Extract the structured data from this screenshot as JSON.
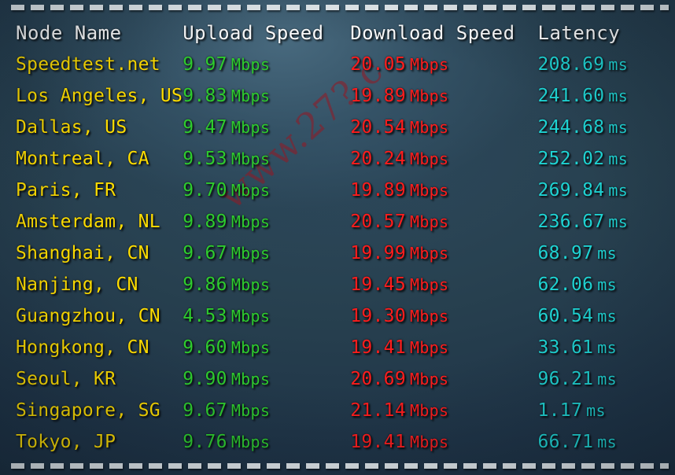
{
  "watermark": {
    "text": "www.27?.c"
  },
  "colors": {
    "node": "#ffdd00",
    "upload": "#2ecc2e",
    "download": "#ff1d1d",
    "latency": "#1fd3d3",
    "header": "#ffffff",
    "background": "#27404f",
    "rule": "#e8eef1",
    "watermark": "#961822"
  },
  "units": {
    "speed": "Mbps",
    "latency": "ms"
  },
  "table": {
    "headers": {
      "node": "Node Name",
      "upload": "Upload Speed",
      "download": "Download Speed",
      "latency": "Latency"
    },
    "rows": [
      {
        "node": "Speedtest.net",
        "upload": "9.97",
        "upload_unit": "Mbps",
        "download": "20.05",
        "download_unit": "Mbps",
        "latency": "208.69",
        "latency_unit": "ms"
      },
      {
        "node": "Los Angeles, US",
        "upload": "9.83",
        "upload_unit": "Mbps",
        "download": "19.89",
        "download_unit": "Mbps",
        "latency": "241.60",
        "latency_unit": "ms"
      },
      {
        "node": "Dallas, US",
        "upload": "9.47",
        "upload_unit": "Mbps",
        "download": "20.54",
        "download_unit": "Mbps",
        "latency": "244.68",
        "latency_unit": "ms"
      },
      {
        "node": "Montreal, CA",
        "upload": "9.53",
        "upload_unit": "Mbps",
        "download": "20.24",
        "download_unit": "Mbps",
        "latency": "252.02",
        "latency_unit": "ms"
      },
      {
        "node": "Paris, FR",
        "upload": "9.70",
        "upload_unit": "Mbps",
        "download": "19.89",
        "download_unit": "Mbps",
        "latency": "269.84",
        "latency_unit": "ms"
      },
      {
        "node": "Amsterdam, NL",
        "upload": "9.89",
        "upload_unit": "Mbps",
        "download": "20.57",
        "download_unit": "Mbps",
        "latency": "236.67",
        "latency_unit": "ms"
      },
      {
        "node": "Shanghai, CN",
        "upload": "9.67",
        "upload_unit": "Mbps",
        "download": "19.99",
        "download_unit": "Mbps",
        "latency": "68.97",
        "latency_unit": "ms"
      },
      {
        "node": "Nanjing, CN",
        "upload": "9.86",
        "upload_unit": "Mbps",
        "download": "19.45",
        "download_unit": "Mbps",
        "latency": "62.06",
        "latency_unit": "ms"
      },
      {
        "node": "Guangzhou, CN",
        "upload": "4.53",
        "upload_unit": "Mbps",
        "download": "19.30",
        "download_unit": "Mbps",
        "latency": "60.54",
        "latency_unit": "ms"
      },
      {
        "node": "Hongkong, CN",
        "upload": "9.60",
        "upload_unit": "Mbps",
        "download": "19.41",
        "download_unit": "Mbps",
        "latency": "33.61",
        "latency_unit": "ms"
      },
      {
        "node": "Seoul, KR",
        "upload": "9.90",
        "upload_unit": "Mbps",
        "download": "20.69",
        "download_unit": "Mbps",
        "latency": "96.21",
        "latency_unit": "ms"
      },
      {
        "node": "Singapore, SG",
        "upload": "9.67",
        "upload_unit": "Mbps",
        "download": "21.14",
        "download_unit": "Mbps",
        "latency": "1.17",
        "latency_unit": "ms"
      },
      {
        "node": "Tokyo, JP",
        "upload": "9.76",
        "upload_unit": "Mbps",
        "download": "19.41",
        "download_unit": "Mbps",
        "latency": "66.71",
        "latency_unit": "ms"
      }
    ]
  }
}
